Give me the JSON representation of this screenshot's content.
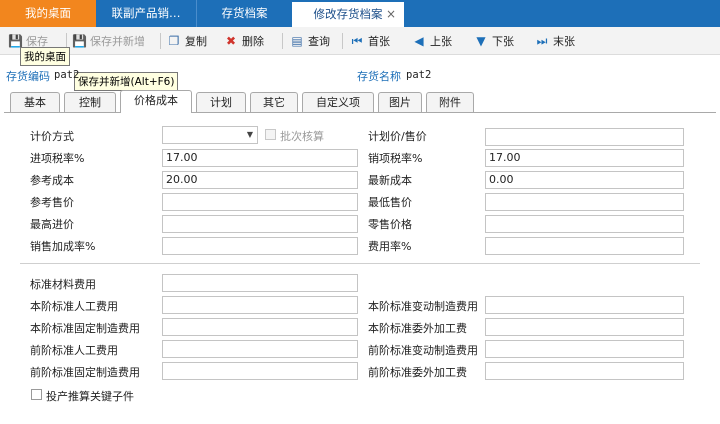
{
  "tabs": {
    "home": "我的桌面",
    "t2": "联副产品销…",
    "t3": "存货档案",
    "active": "修改存货档案",
    "close": "×"
  },
  "toolbar": {
    "save": "保存",
    "save_new": "保存并新增",
    "copy": "复制",
    "delete": "删除",
    "query": "查询",
    "first": "首张",
    "prev": "上张",
    "next": "下张",
    "last": "末张"
  },
  "tooltips": {
    "desktop": "我的桌面",
    "save_new": "保存并新增(Alt+F6)"
  },
  "header": {
    "code_label": "存货编码",
    "code_value": "pat2",
    "name_label": "存货名称",
    "name_value": "pat2"
  },
  "inner_tabs": [
    "基本",
    "控制",
    "价格成本",
    "计划",
    "其它",
    "自定义项",
    "图片",
    "附件"
  ],
  "form": {
    "pricing_method": "计价方式",
    "pricing_method_value": "",
    "batch_check": "批次核算",
    "plan_price": "计划价/售价",
    "input_tax": "进项税率%",
    "input_tax_value": "17.00",
    "output_tax": "销项税率%",
    "output_tax_value": "17.00",
    "ref_cost": "参考成本",
    "ref_cost_value": "20.00",
    "latest_cost": "最新成本",
    "latest_cost_value": "0.00",
    "ref_price": "参考售价",
    "min_price": "最低售价",
    "max_purchase": "最高进价",
    "retail_price": "零售价格",
    "sales_markup": "销售加成率%",
    "expense_rate": "费用率%",
    "std_material": "标准材料费用",
    "cur_labor": "本阶标准人工费用",
    "cur_var_mfg": "本阶标准变动制造费用",
    "cur_fixed_mfg": "本阶标准固定制造费用",
    "cur_outsource": "本阶标准委外加工费",
    "prev_labor": "前阶标准人工费用",
    "prev_var_mfg": "前阶标准变动制造费用",
    "prev_fixed_mfg": "前阶标准固定制造费用",
    "prev_outsource": "前阶标准委外加工费",
    "key_child": "投产推算关键子件"
  }
}
